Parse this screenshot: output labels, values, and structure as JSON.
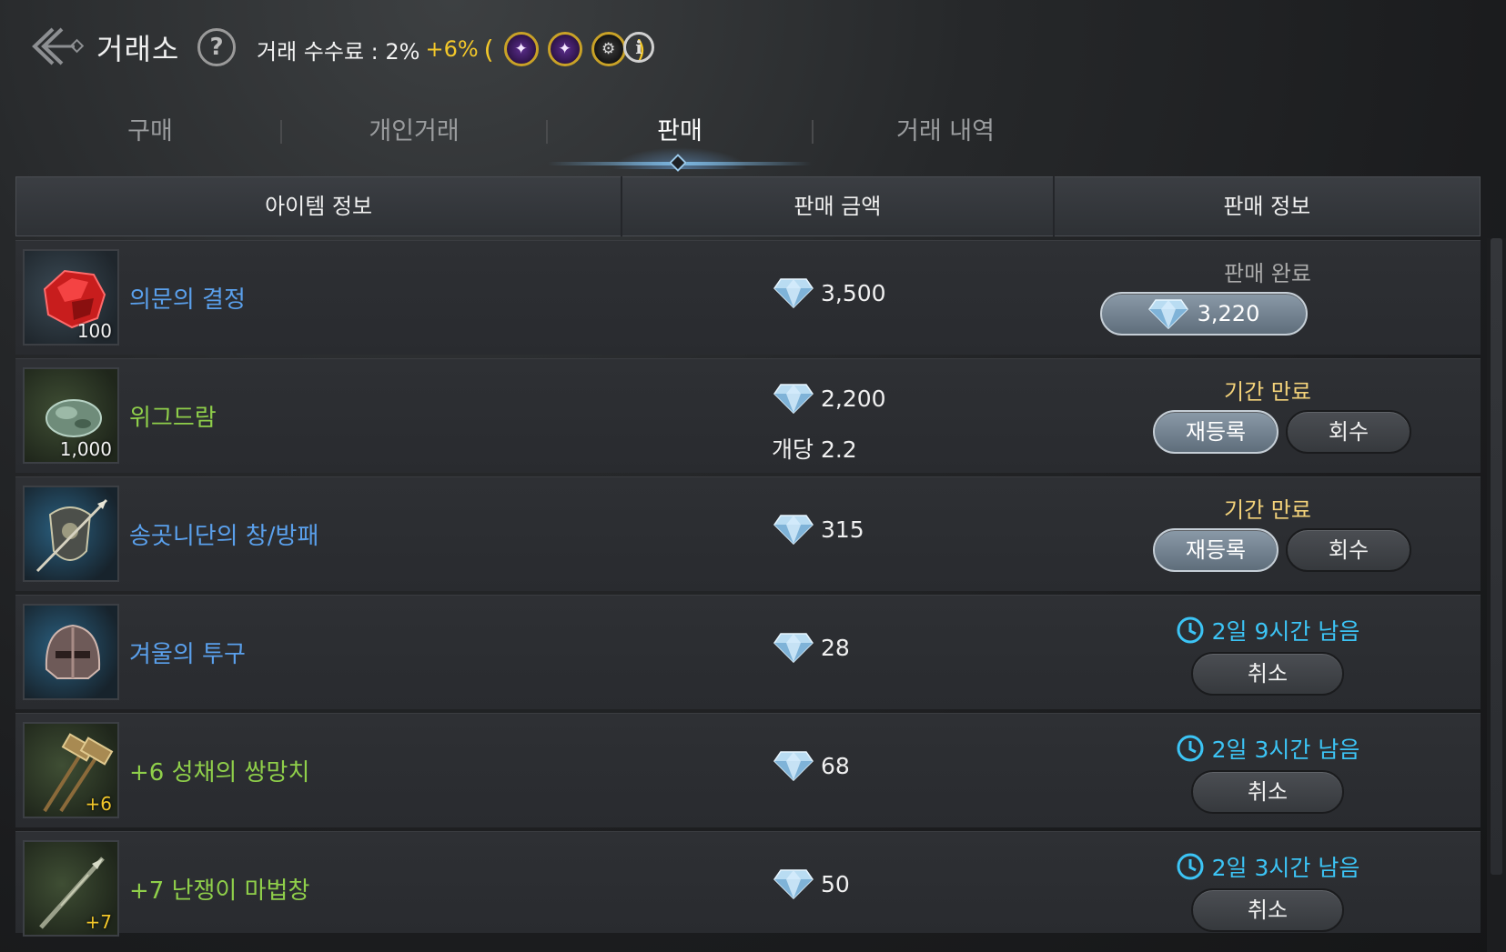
{
  "header": {
    "title": "거래소",
    "help_label": "?",
    "fee_label": "거래 수수료 : 2%",
    "fee_extra": "+6%",
    "paren_open": "(",
    "paren_close": ")",
    "buff_icons": [
      "class-buff-icon",
      "class-buff-icon",
      "settings-buff-icon"
    ],
    "info_label": "i"
  },
  "tabs": [
    {
      "label": "구매",
      "active": false
    },
    {
      "label": "개인거래",
      "active": false
    },
    {
      "label": "판매",
      "active": true
    },
    {
      "label": "거래 내역",
      "active": false
    }
  ],
  "table": {
    "headers": [
      "아이템 정보",
      "판매 금액",
      "판매 정보"
    ],
    "rows": [
      {
        "name": "의문의 결정",
        "qty": "100",
        "price": "3,500",
        "status": "판매 완료",
        "amount": "3,220"
      },
      {
        "name": "위그드람",
        "qty": "1,000",
        "price": "2,200",
        "unit_price": "개당 2.2",
        "status": "기간 만료",
        "btn1": "재등록",
        "btn2": "회수"
      },
      {
        "name": "송곳니단의 창/방패",
        "qty": "",
        "price": "315",
        "status": "기간 만료",
        "btn1": "재등록",
        "btn2": "회수"
      },
      {
        "name": "겨울의 투구",
        "qty": "",
        "price": "28",
        "timer": "2일 9시간 남음",
        "btn": "취소"
      },
      {
        "name": "+6 성채의 쌍망치",
        "qty": "+6",
        "price": "68",
        "timer": "2일 3시간 남음",
        "btn": "취소"
      },
      {
        "name": "+7 난쟁이 마법창",
        "qty": "+7",
        "price": "50",
        "timer": "2일 3시간 남음",
        "btn": "취소"
      }
    ]
  },
  "colors": {
    "accent_gold": "#f3c82a",
    "name_blue": "#5aa0ec",
    "name_green": "#8fcf4a",
    "timer_cyan": "#3cc4f5"
  }
}
